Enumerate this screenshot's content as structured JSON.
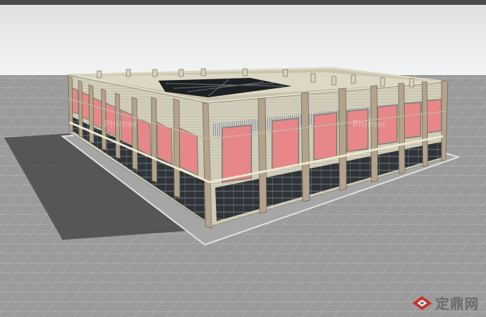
{
  "scene": {
    "sky_color": "#e9ebec",
    "ground_color": "#9b9b9b",
    "facade_color": "#d4d0bd",
    "pier_color": "#b0a088",
    "window_color": "#e7878a",
    "glass_color": "#3a3e42",
    "shadow_color": "#4d4d4d"
  },
  "watermarks": {
    "left": "Phimer",
    "right": "Phimer"
  },
  "brand": {
    "logo_icon": "diamond-logo-icon",
    "text": "定鼎网"
  }
}
